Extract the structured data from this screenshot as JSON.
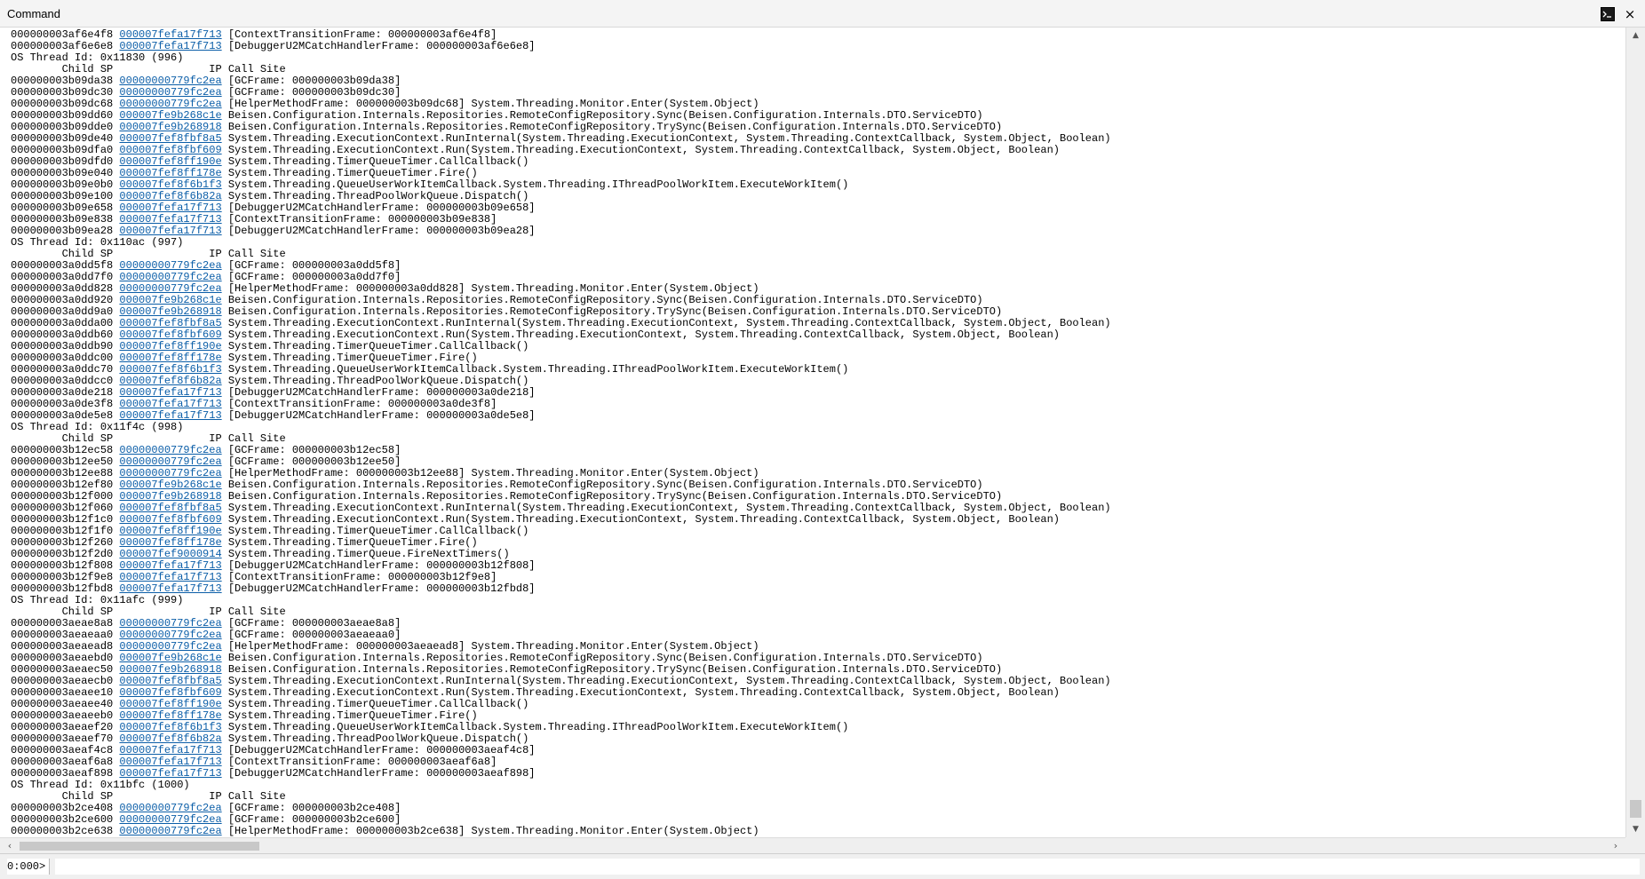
{
  "window": {
    "title": "Command",
    "close_label": "×"
  },
  "command": {
    "prompt": "0:000>",
    "value": ""
  },
  "output_lines": [
    {
      "sp": "000000003af6e4f8",
      "ip": "000007fefa17f713",
      "site": "[ContextTransitionFrame: 000000003af6e4f8]"
    },
    {
      "sp": "000000003af6e6e8",
      "ip": "000007fefa17f713",
      "site": "[DebuggerU2MCatchHandlerFrame: 000000003af6e6e8]"
    },
    {
      "text": "OS Thread Id: 0x11830 (996)"
    },
    {
      "text": "        Child SP               IP Call Site"
    },
    {
      "sp": "000000003b09da38",
      "ip": "00000000779fc2ea",
      "site": "[GCFrame: 000000003b09da38]"
    },
    {
      "sp": "000000003b09dc30",
      "ip": "00000000779fc2ea",
      "site": "[GCFrame: 000000003b09dc30]"
    },
    {
      "sp": "000000003b09dc68",
      "ip": "00000000779fc2ea",
      "site": "[HelperMethodFrame: 000000003b09dc68] System.Threading.Monitor.Enter(System.Object)"
    },
    {
      "sp": "000000003b09dd60",
      "ip": "000007fe9b268c1e",
      "site": "Beisen.Configuration.Internals.Repositories.RemoteConfigRepository.Sync(Beisen.Configuration.Internals.DTO.ServiceDTO)"
    },
    {
      "sp": "000000003b09dde0",
      "ip": "000007fe9b268918",
      "site": "Beisen.Configuration.Internals.Repositories.RemoteConfigRepository.TrySync(Beisen.Configuration.Internals.DTO.ServiceDTO)"
    },
    {
      "sp": "000000003b09de40",
      "ip": "000007fef8fbf8a5",
      "site": "System.Threading.ExecutionContext.RunInternal(System.Threading.ExecutionContext, System.Threading.ContextCallback, System.Object, Boolean)"
    },
    {
      "sp": "000000003b09dfa0",
      "ip": "000007fef8fbf609",
      "site": "System.Threading.ExecutionContext.Run(System.Threading.ExecutionContext, System.Threading.ContextCallback, System.Object, Boolean)"
    },
    {
      "sp": "000000003b09dfd0",
      "ip": "000007fef8ff190e",
      "site": "System.Threading.TimerQueueTimer.CallCallback()"
    },
    {
      "sp": "000000003b09e040",
      "ip": "000007fef8ff178e",
      "site": "System.Threading.TimerQueueTimer.Fire()"
    },
    {
      "sp": "000000003b09e0b0",
      "ip": "000007fef8f6b1f3",
      "site": "System.Threading.QueueUserWorkItemCallback.System.Threading.IThreadPoolWorkItem.ExecuteWorkItem()"
    },
    {
      "sp": "000000003b09e100",
      "ip": "000007fef8f6b82a",
      "site": "System.Threading.ThreadPoolWorkQueue.Dispatch()"
    },
    {
      "sp": "000000003b09e658",
      "ip": "000007fefa17f713",
      "site": "[DebuggerU2MCatchHandlerFrame: 000000003b09e658]"
    },
    {
      "sp": "000000003b09e838",
      "ip": "000007fefa17f713",
      "site": "[ContextTransitionFrame: 000000003b09e838]"
    },
    {
      "sp": "000000003b09ea28",
      "ip": "000007fefa17f713",
      "site": "[DebuggerU2MCatchHandlerFrame: 000000003b09ea28]"
    },
    {
      "text": "OS Thread Id: 0x110ac (997)"
    },
    {
      "text": "        Child SP               IP Call Site"
    },
    {
      "sp": "000000003a0dd5f8",
      "ip": "00000000779fc2ea",
      "site": "[GCFrame: 000000003a0dd5f8]"
    },
    {
      "sp": "000000003a0dd7f0",
      "ip": "00000000779fc2ea",
      "site": "[GCFrame: 000000003a0dd7f0]"
    },
    {
      "sp": "000000003a0dd828",
      "ip": "00000000779fc2ea",
      "site": "[HelperMethodFrame: 000000003a0dd828] System.Threading.Monitor.Enter(System.Object)"
    },
    {
      "sp": "000000003a0dd920",
      "ip": "000007fe9b268c1e",
      "site": "Beisen.Configuration.Internals.Repositories.RemoteConfigRepository.Sync(Beisen.Configuration.Internals.DTO.ServiceDTO)"
    },
    {
      "sp": "000000003a0dd9a0",
      "ip": "000007fe9b268918",
      "site": "Beisen.Configuration.Internals.Repositories.RemoteConfigRepository.TrySync(Beisen.Configuration.Internals.DTO.ServiceDTO)"
    },
    {
      "sp": "000000003a0dda00",
      "ip": "000007fef8fbf8a5",
      "site": "System.Threading.ExecutionContext.RunInternal(System.Threading.ExecutionContext, System.Threading.ContextCallback, System.Object, Boolean)"
    },
    {
      "sp": "000000003a0ddb60",
      "ip": "000007fef8fbf609",
      "site": "System.Threading.ExecutionContext.Run(System.Threading.ExecutionContext, System.Threading.ContextCallback, System.Object, Boolean)"
    },
    {
      "sp": "000000003a0ddb90",
      "ip": "000007fef8ff190e",
      "site": "System.Threading.TimerQueueTimer.CallCallback()"
    },
    {
      "sp": "000000003a0ddc00",
      "ip": "000007fef8ff178e",
      "site": "System.Threading.TimerQueueTimer.Fire()"
    },
    {
      "sp": "000000003a0ddc70",
      "ip": "000007fef8f6b1f3",
      "site": "System.Threading.QueueUserWorkItemCallback.System.Threading.IThreadPoolWorkItem.ExecuteWorkItem()"
    },
    {
      "sp": "000000003a0ddcc0",
      "ip": "000007fef8f6b82a",
      "site": "System.Threading.ThreadPoolWorkQueue.Dispatch()"
    },
    {
      "sp": "000000003a0de218",
      "ip": "000007fefa17f713",
      "site": "[DebuggerU2MCatchHandlerFrame: 000000003a0de218]"
    },
    {
      "sp": "000000003a0de3f8",
      "ip": "000007fefa17f713",
      "site": "[ContextTransitionFrame: 000000003a0de3f8]"
    },
    {
      "sp": "000000003a0de5e8",
      "ip": "000007fefa17f713",
      "site": "[DebuggerU2MCatchHandlerFrame: 000000003a0de5e8]"
    },
    {
      "text": "OS Thread Id: 0x11f4c (998)"
    },
    {
      "text": "        Child SP               IP Call Site"
    },
    {
      "sp": "000000003b12ec58",
      "ip": "00000000779fc2ea",
      "site": "[GCFrame: 000000003b12ec58]"
    },
    {
      "sp": "000000003b12ee50",
      "ip": "00000000779fc2ea",
      "site": "[GCFrame: 000000003b12ee50]"
    },
    {
      "sp": "000000003b12ee88",
      "ip": "00000000779fc2ea",
      "site": "[HelperMethodFrame: 000000003b12ee88] System.Threading.Monitor.Enter(System.Object)"
    },
    {
      "sp": "000000003b12ef80",
      "ip": "000007fe9b268c1e",
      "site": "Beisen.Configuration.Internals.Repositories.RemoteConfigRepository.Sync(Beisen.Configuration.Internals.DTO.ServiceDTO)"
    },
    {
      "sp": "000000003b12f000",
      "ip": "000007fe9b268918",
      "site": "Beisen.Configuration.Internals.Repositories.RemoteConfigRepository.TrySync(Beisen.Configuration.Internals.DTO.ServiceDTO)"
    },
    {
      "sp": "000000003b12f060",
      "ip": "000007fef8fbf8a5",
      "site": "System.Threading.ExecutionContext.RunInternal(System.Threading.ExecutionContext, System.Threading.ContextCallback, System.Object, Boolean)"
    },
    {
      "sp": "000000003b12f1c0",
      "ip": "000007fef8fbf609",
      "site": "System.Threading.ExecutionContext.Run(System.Threading.ExecutionContext, System.Threading.ContextCallback, System.Object, Boolean)"
    },
    {
      "sp": "000000003b12f1f0",
      "ip": "000007fef8ff190e",
      "site": "System.Threading.TimerQueueTimer.CallCallback()"
    },
    {
      "sp": "000000003b12f260",
      "ip": "000007fef8ff178e",
      "site": "System.Threading.TimerQueueTimer.Fire()"
    },
    {
      "sp": "000000003b12f2d0",
      "ip": "000007fef9000914",
      "site": "System.Threading.TimerQueue.FireNextTimers()"
    },
    {
      "sp": "000000003b12f808",
      "ip": "000007fefa17f713",
      "site": "[DebuggerU2MCatchHandlerFrame: 000000003b12f808]"
    },
    {
      "sp": "000000003b12f9e8",
      "ip": "000007fefa17f713",
      "site": "[ContextTransitionFrame: 000000003b12f9e8]"
    },
    {
      "sp": "000000003b12fbd8",
      "ip": "000007fefa17f713",
      "site": "[DebuggerU2MCatchHandlerFrame: 000000003b12fbd8]"
    },
    {
      "text": "OS Thread Id: 0x11afc (999)"
    },
    {
      "text": "        Child SP               IP Call Site"
    },
    {
      "sp": "000000003aeae8a8",
      "ip": "00000000779fc2ea",
      "site": "[GCFrame: 000000003aeae8a8]"
    },
    {
      "sp": "000000003aeaeaa0",
      "ip": "00000000779fc2ea",
      "site": "[GCFrame: 000000003aeaeaa0]"
    },
    {
      "sp": "000000003aeaead8",
      "ip": "00000000779fc2ea",
      "site": "[HelperMethodFrame: 000000003aeaead8] System.Threading.Monitor.Enter(System.Object)"
    },
    {
      "sp": "000000003aeaebd0",
      "ip": "000007fe9b268c1e",
      "site": "Beisen.Configuration.Internals.Repositories.RemoteConfigRepository.Sync(Beisen.Configuration.Internals.DTO.ServiceDTO)"
    },
    {
      "sp": "000000003aeaec50",
      "ip": "000007fe9b268918",
      "site": "Beisen.Configuration.Internals.Repositories.RemoteConfigRepository.TrySync(Beisen.Configuration.Internals.DTO.ServiceDTO)"
    },
    {
      "sp": "000000003aeaecb0",
      "ip": "000007fef8fbf8a5",
      "site": "System.Threading.ExecutionContext.RunInternal(System.Threading.ExecutionContext, System.Threading.ContextCallback, System.Object, Boolean)"
    },
    {
      "sp": "000000003aeaee10",
      "ip": "000007fef8fbf609",
      "site": "System.Threading.ExecutionContext.Run(System.Threading.ExecutionContext, System.Threading.ContextCallback, System.Object, Boolean)"
    },
    {
      "sp": "000000003aeaee40",
      "ip": "000007fef8ff190e",
      "site": "System.Threading.TimerQueueTimer.CallCallback()"
    },
    {
      "sp": "000000003aeaeeb0",
      "ip": "000007fef8ff178e",
      "site": "System.Threading.TimerQueueTimer.Fire()"
    },
    {
      "sp": "000000003aeaef20",
      "ip": "000007fef8f6b1f3",
      "site": "System.Threading.QueueUserWorkItemCallback.System.Threading.IThreadPoolWorkItem.ExecuteWorkItem()"
    },
    {
      "sp": "000000003aeaef70",
      "ip": "000007fef8f6b82a",
      "site": "System.Threading.ThreadPoolWorkQueue.Dispatch()"
    },
    {
      "sp": "000000003aeaf4c8",
      "ip": "000007fefa17f713",
      "site": "[DebuggerU2MCatchHandlerFrame: 000000003aeaf4c8]"
    },
    {
      "sp": "000000003aeaf6a8",
      "ip": "000007fefa17f713",
      "site": "[ContextTransitionFrame: 000000003aeaf6a8]"
    },
    {
      "sp": "000000003aeaf898",
      "ip": "000007fefa17f713",
      "site": "[DebuggerU2MCatchHandlerFrame: 000000003aeaf898]"
    },
    {
      "text": "OS Thread Id: 0x11bfc (1000)"
    },
    {
      "text": "        Child SP               IP Call Site"
    },
    {
      "sp": "000000003b2ce408",
      "ip": "00000000779fc2ea",
      "site": "[GCFrame: 000000003b2ce408]"
    },
    {
      "sp": "000000003b2ce600",
      "ip": "00000000779fc2ea",
      "site": "[GCFrame: 000000003b2ce600]"
    },
    {
      "sp": "000000003b2ce638",
      "ip": "00000000779fc2ea",
      "site": "[HelperMethodFrame: 000000003b2ce638] System.Threading.Monitor.Enter(System.Object)"
    }
  ]
}
